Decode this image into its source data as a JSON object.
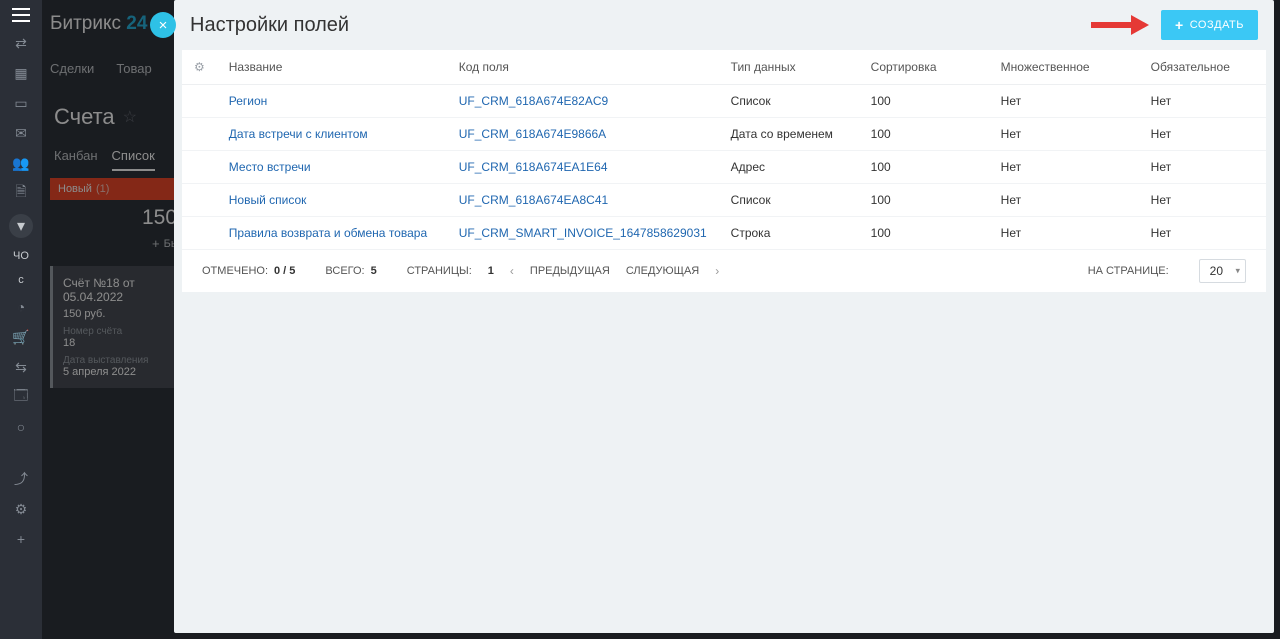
{
  "brand": {
    "name": "Битрикс",
    "suffix": "24"
  },
  "sidebar": {
    "avatar_initials": "ЧО",
    "stub": "с"
  },
  "bg_tabs": [
    "Сделки",
    "Товар"
  ],
  "page": {
    "title": "Счета"
  },
  "view_tabs": {
    "kanban": "Канбан",
    "list": "Список"
  },
  "stage": {
    "label": "Новый",
    "count": "(1)",
    "value": "150"
  },
  "fast_create": "Быстр",
  "card": {
    "title": "Счёт №18 от 05.04.2022",
    "price": "150 руб.",
    "num_lbl": "Номер счёта",
    "num_val": "18",
    "date_lbl": "Дата выставления",
    "date_val": "5 апреля 2022"
  },
  "panel": {
    "title": "Настройки полей",
    "create": "СОЗДАТЬ",
    "columns": {
      "name": "Название",
      "code": "Код поля",
      "type": "Тип данных",
      "sort": "Сортировка",
      "multi": "Множественное",
      "required": "Обязательное"
    },
    "rows": [
      {
        "name": "Регион",
        "code": "UF_CRM_618A674E82AC9",
        "type": "Список",
        "sort": "100",
        "multi": "Нет",
        "required": "Нет"
      },
      {
        "name": "Дата встречи с клиентом",
        "code": "UF_CRM_618A674E9866A",
        "type": "Дата со временем",
        "sort": "100",
        "multi": "Нет",
        "required": "Нет"
      },
      {
        "name": "Место встречи",
        "code": "UF_CRM_618A674EA1E64",
        "type": "Адрес",
        "sort": "100",
        "multi": "Нет",
        "required": "Нет"
      },
      {
        "name": "Новый список",
        "code": "UF_CRM_618A674EA8C41",
        "type": "Список",
        "sort": "100",
        "multi": "Нет",
        "required": "Нет"
      },
      {
        "name": "Правила возврата и обмена товара",
        "code": "UF_CRM_SMART_INVOICE_1647858629031",
        "type": "Строка",
        "sort": "100",
        "multi": "Нет",
        "required": "Нет"
      }
    ],
    "pager": {
      "selected_label": "ОТМЕЧЕНО:",
      "selected_value": "0 / 5",
      "total_label": "ВСЕГО:",
      "total_value": "5",
      "pages_label": "СТРАНИЦЫ:",
      "pages_value": "1",
      "prev": "ПРЕДЫДУЩАЯ",
      "next": "СЛЕДУЮЩАЯ",
      "per_page_label": "НА СТРАНИЦЕ:",
      "per_page_value": "20"
    }
  }
}
